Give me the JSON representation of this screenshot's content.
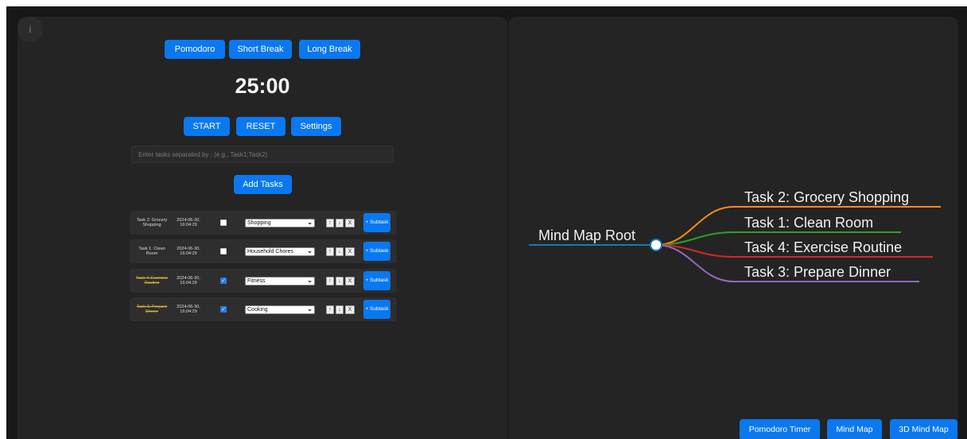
{
  "timer_panel": {
    "modes": [
      "Pomodoro",
      "Short Break",
      "Long Break"
    ],
    "time": "25:00",
    "controls": {
      "start": "START",
      "reset": "RESET",
      "settings": "Settings"
    },
    "task_input": {
      "placeholder": "Enter tasks separated by ; (e.g., Task1;Task2)",
      "value": ""
    },
    "add_tasks_label": "Add Tasks",
    "tasks": [
      {
        "name": "Task 2: Grocery Shopping",
        "date": "2024-06-30, 16:04:29",
        "done": false,
        "category": "Shopping"
      },
      {
        "name": "Task 1: Clean Room",
        "date": "2024-06-30, 16:04:29",
        "done": false,
        "category": "Household Chores"
      },
      {
        "name": "Task 4: Exercise Routine",
        "date": "2024-06-30, 16:04:29",
        "done": true,
        "category": "Fitness"
      },
      {
        "name": "Task 3: Prepare Dinner",
        "date": "2024-06-30, 16:04:29",
        "done": true,
        "category": "Cooking"
      }
    ],
    "row_buttons": {
      "up": "↑",
      "down": "↓",
      "delete": "X",
      "subtask": "+ Subtask"
    }
  },
  "mind_map": {
    "root": "Mind Map Root",
    "branches": [
      {
        "label": "Task 2: Grocery Shopping",
        "color": "#ff8c1a"
      },
      {
        "label": "Task 1: Clean Room",
        "color": "#2ca02c"
      },
      {
        "label": "Task 4: Exercise Routine",
        "color": "#d62728"
      },
      {
        "label": "Task 3: Prepare Dinner",
        "color": "#9467bd"
      }
    ],
    "root_color": "#1f77b4"
  },
  "nav": {
    "pomodoro_timer": "Pomodoro Timer",
    "mind_map": "Mind Map",
    "mind_map_3d": "3D Mind Map"
  },
  "colors": {
    "accent": "#0a78f0",
    "panel": "#242424",
    "background": "#181818",
    "done_text": "#d3b33a"
  }
}
